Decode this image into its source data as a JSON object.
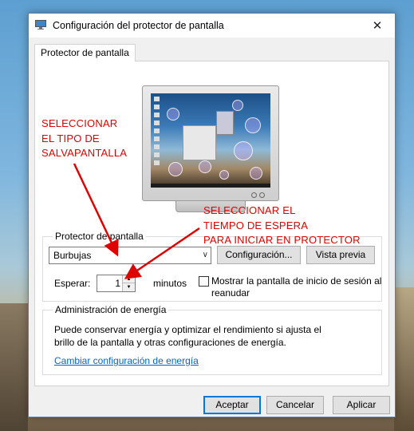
{
  "window": {
    "title": "Configuración del protector de pantalla",
    "close_glyph": "✕"
  },
  "tab": {
    "label": "Protector de pantalla"
  },
  "screensaver_group": {
    "legend": "Protector de pantalla",
    "selected": "Burbujas",
    "settings_button": "Configuración...",
    "preview_button": "Vista previa",
    "wait_label": "Esperar:",
    "wait_value": "1",
    "minutes_label": "minutos",
    "resume_checkbox_label": "Mostrar la pantalla de inicio de sesión al reanudar",
    "resume_checked": false
  },
  "power_group": {
    "legend": "Administración de energía",
    "description": "Puede conservar energía y optimizar el rendimiento si ajusta el brillo de la pantalla y otras configuraciones de energía.",
    "link": "Cambiar configuración de energía"
  },
  "buttons": {
    "ok": "Aceptar",
    "cancel": "Cancelar",
    "apply": "Aplicar"
  },
  "annotations": {
    "type_note_lines": [
      "SELECCIONAR",
      "EL TIPO DE",
      "SALVAPANTALLA"
    ],
    "time_note_lines": [
      "SELECCIONAR EL",
      "TIEMPO DE ESPERA",
      "PARA INICIAR EN PROTECTOR"
    ],
    "color": "#e00000"
  },
  "icons": {
    "title_icon": "screensaver-monitor-icon",
    "dropdown": "chevron-down-icon",
    "stepper_up": "triangle-up-icon",
    "stepper_down": "triangle-down-icon"
  }
}
